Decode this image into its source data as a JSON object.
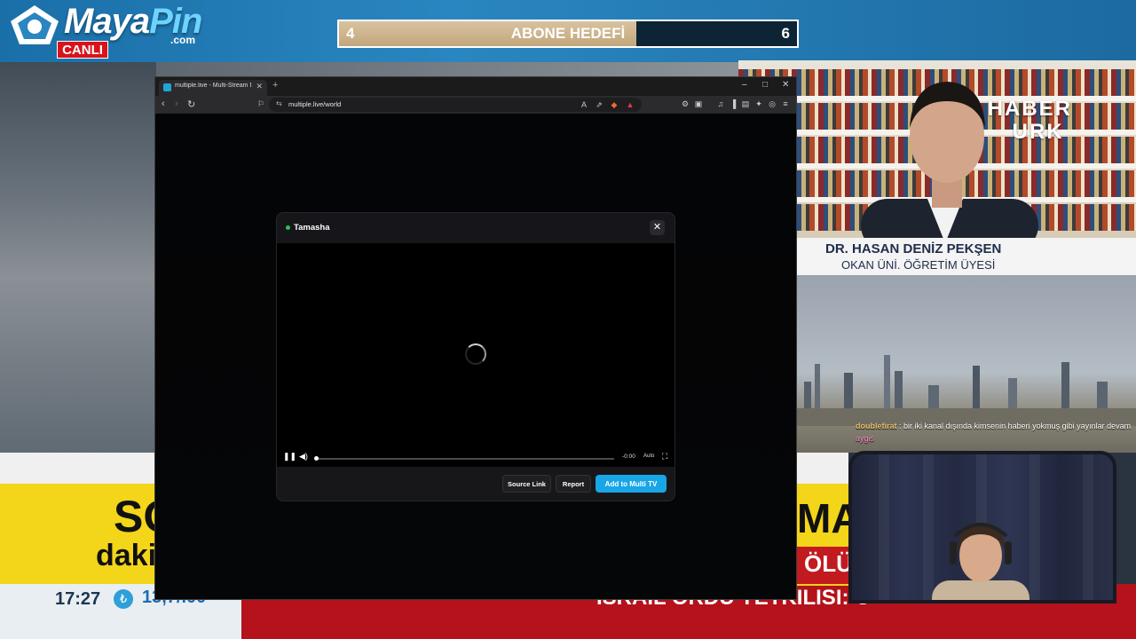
{
  "overlay": {
    "brand_main": "Maya",
    "brand_accent": "Pin",
    "brand_domain": ".com",
    "live_badge": "CANLI",
    "goal": {
      "label": "ABONE HEDEFİ",
      "current": "4",
      "target": "6",
      "progress_fraction": 0.65
    },
    "channel_logo_line1": "HABER",
    "channel_logo_line2": "URK",
    "guest_name": "DR. HASAN DENİZ PEKŞEN",
    "guest_title": "OKAN ÜNİ. ÖĞRETİM ÜYESİ",
    "chat": {
      "user": "doublefirat",
      "message": ": bir iki kanal dışında kimsenin haberi yokmuş gibi yayınlar devam",
      "user2": "aygis"
    },
    "left_headline_big": "SO",
    "left_headline_small": "daki",
    "right_headline_big": "MA",
    "right_subline": "ÖLÜ",
    "ticker_time": "17:27",
    "ticker_value": "13,7/.00",
    "ticker_text": "ISRAIL ORDU YETKILISI: O"
  },
  "browser": {
    "tab_title": "multiple.live - Multi-Stream Dashboard",
    "url": "multiple.live/world",
    "window_controls": {
      "minimize": "–",
      "maximize": "□",
      "close": "✕"
    }
  },
  "modal": {
    "title": "Tamasha",
    "time": "-0:00",
    "quality": "Auto",
    "buttons": {
      "source": "Source Link",
      "report": "Report",
      "add": "Add to Multi TV"
    }
  },
  "colors": {
    "accent": "#19a6e6",
    "live_dot": "#22c55e",
    "live_badge": "#d8141b",
    "ticker_red": "#b5121b"
  }
}
